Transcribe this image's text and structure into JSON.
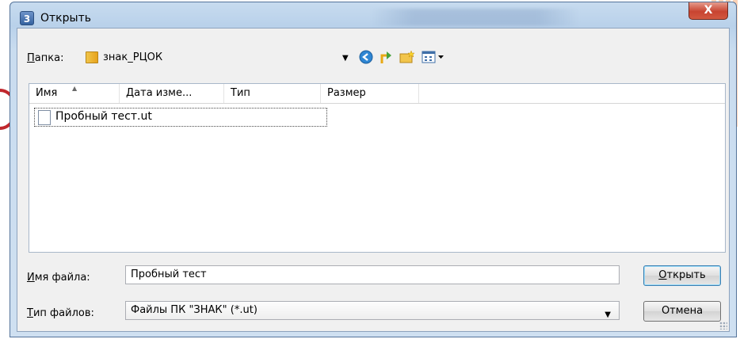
{
  "dialog": {
    "title": "Открыть",
    "icon": "app-icon",
    "close_label": "X",
    "folder_label_u": "П",
    "folder_label_rest": "апка:",
    "folder_value": "знак_РЦОК",
    "columns": [
      "Имя",
      "Дата изме...",
      "Тип",
      "Размер"
    ],
    "files": [
      {
        "name": "Пробный тест.ut",
        "icon": "document-icon"
      }
    ],
    "filename_label_u": "И",
    "filename_label_rest": "мя файла:",
    "filename_value": "Пробный тест",
    "filetype_label_u": "Т",
    "filetype_label_rest": "ип файлов:",
    "filetype_value": "Файлы ПК \"ЗНАК\" (*.ut)",
    "open_button_u": "О",
    "open_button_rest": "ткрыть",
    "cancel_button": "Отмена"
  },
  "colors": {
    "title_gradient": "#b9d1ea",
    "close_button": "#c84431",
    "client_bg": "#f0f0f0"
  }
}
